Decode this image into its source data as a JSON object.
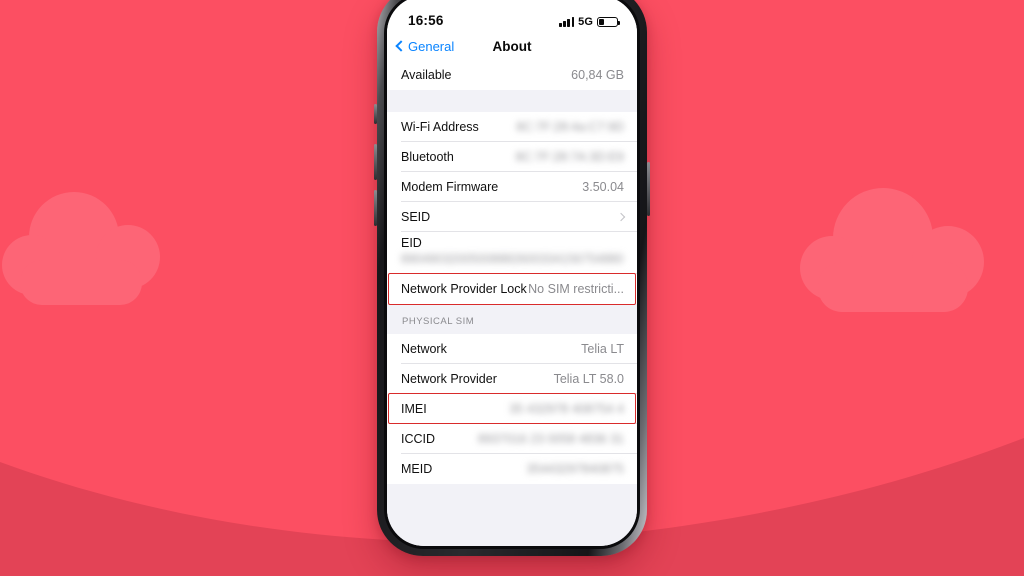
{
  "background": {
    "base_color": "#FC4F62",
    "cloud_color": "#FD6576",
    "hill_color": "#E34356",
    "shapes": [
      "cloud-left",
      "cloud-right",
      "hill-bottom"
    ]
  },
  "device": {
    "type": "iphone-mockup",
    "frame_color": "#17171A"
  },
  "status_bar": {
    "time": "16:56",
    "signal_icon": "cellular-bars-icon",
    "network_label": "5G",
    "battery_icon": "battery-icon",
    "battery_level_pct": 27
  },
  "nav_bar": {
    "back_icon": "chevron-left-icon",
    "back_label": "General",
    "title": "About"
  },
  "sections": [
    {
      "header": "",
      "rows": [
        {
          "label": "Available",
          "value": "60,84 GB",
          "redacted": false,
          "accessory": "none"
        }
      ]
    },
    {
      "header": "",
      "rows": [
        {
          "label": "Wi-Fi Address",
          "value": "8C:7F:28:4a:C7:9D",
          "redacted": true,
          "accessory": "none"
        },
        {
          "label": "Bluetooth",
          "value": "8C:7F:28:7A:3D:E9",
          "redacted": true,
          "accessory": "none"
        },
        {
          "label": "Modem Firmware",
          "value": "3.50.04",
          "redacted": false,
          "accessory": "none"
        },
        {
          "label": "SEID",
          "value": "",
          "redacted": false,
          "accessory": "chevron"
        },
        {
          "label": "EID",
          "value": "89049032005008882600334156754880",
          "redacted": true,
          "accessory": "none",
          "two_line": true
        },
        {
          "label": "Network Provider Lock",
          "value": "No SIM restricti...",
          "redacted": false,
          "accessory": "none",
          "highlighted": true
        }
      ]
    },
    {
      "header": "PHYSICAL SIM",
      "rows": [
        {
          "label": "Network",
          "value": "Telia LT",
          "redacted": false,
          "accessory": "none"
        },
        {
          "label": "Network Provider",
          "value": "Telia LT 58.0",
          "redacted": false,
          "accessory": "none"
        },
        {
          "label": "IMEI",
          "value": "35 432978 408754 4",
          "redacted": true,
          "accessory": "none",
          "highlighted": true
        },
        {
          "label": "ICCID",
          "value": "8937016 23 0058 4836 31",
          "redacted": true,
          "accessory": "none"
        },
        {
          "label": "MEID",
          "value": "35443297840875",
          "redacted": true,
          "accessory": "none"
        }
      ]
    }
  ],
  "annotations": {
    "highlight_color": "#D92B2B",
    "boxes": [
      {
        "target": "Network Provider Lock"
      },
      {
        "target": "IMEI"
      }
    ]
  }
}
